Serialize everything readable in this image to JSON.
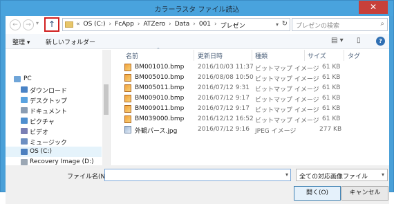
{
  "window": {
    "title": "カラーラスタ ファイル読込",
    "close_glyph": "✕"
  },
  "nav": {
    "back_glyph": "←",
    "forward_glyph": "→",
    "dropdown_glyph": "▾",
    "up_glyph": "↑",
    "breadcrumb_prefix": "«",
    "breadcrumbs": [
      "OS (C:)",
      "FcApp",
      "ATZero",
      "Data",
      "001",
      "プレゼン"
    ],
    "breadcrumb_sep": "›",
    "refresh_glyph": "↻",
    "search_placeholder": "プレゼンの検索",
    "search_glyph": "⌕"
  },
  "toolbar": {
    "organize": "整理 ▾",
    "new_folder": "新しいフォルダー",
    "view_glyph": "▤ ▾",
    "pane_glyph": "▯",
    "help_glyph": "?"
  },
  "sidebar": {
    "items": [
      {
        "label": "PC",
        "icon": "pc-icon",
        "color": "#6fa5d8",
        "indent": 0,
        "selected": false
      },
      {
        "label": "ダウンロード",
        "icon": "download-folder-icon",
        "color": "#4a83c6",
        "indent": 1,
        "selected": false
      },
      {
        "label": "デスクトップ",
        "icon": "desktop-folder-icon",
        "color": "#5aa3e0",
        "indent": 1,
        "selected": false
      },
      {
        "label": "ドキュメント",
        "icon": "documents-folder-icon",
        "color": "#8a9db3",
        "indent": 1,
        "selected": false
      },
      {
        "label": "ピクチャ",
        "icon": "pictures-folder-icon",
        "color": "#4f8fcf",
        "indent": 1,
        "selected": false
      },
      {
        "label": "ビデオ",
        "icon": "videos-folder-icon",
        "color": "#7a7fb5",
        "indent": 1,
        "selected": false
      },
      {
        "label": "ミュージック",
        "icon": "music-folder-icon",
        "color": "#6c8fc2",
        "indent": 1,
        "selected": false
      },
      {
        "label": "OS (C:)",
        "icon": "drive-icon",
        "color": "#4b7fbf",
        "indent": 1,
        "selected": true
      },
      {
        "label": "Recovery Image (D:)",
        "icon": "drive-icon",
        "color": "#9ba7b4",
        "indent": 1,
        "selected": false
      }
    ]
  },
  "files": {
    "columns": [
      "名前",
      "更新日時",
      "種類",
      "サイズ",
      "タグ"
    ],
    "sort_glyph": "⌃",
    "rows": [
      {
        "name": "BM001010.bmp",
        "date": "2016/10/03 11:37",
        "type": "ビットマップ イメージ",
        "size": "61 KB",
        "kind": "bmp"
      },
      {
        "name": "BM005010.bmp",
        "date": "2016/08/08 10:50",
        "type": "ビットマップ イメージ",
        "size": "61 KB",
        "kind": "bmp"
      },
      {
        "name": "BM005011.bmp",
        "date": "2016/07/12 9:31",
        "type": "ビットマップ イメージ",
        "size": "61 KB",
        "kind": "bmp"
      },
      {
        "name": "BM009010.bmp",
        "date": "2016/07/12 9:17",
        "type": "ビットマップ イメージ",
        "size": "61 KB",
        "kind": "bmp"
      },
      {
        "name": "BM009011.bmp",
        "date": "2016/07/12 9:17",
        "type": "ビットマップ イメージ",
        "size": "61 KB",
        "kind": "bmp"
      },
      {
        "name": "BM039000.bmp",
        "date": "2016/12/12 16:52",
        "type": "ビットマップ イメージ",
        "size": "61 KB",
        "kind": "bmp"
      },
      {
        "name": "外観パース.jpg",
        "date": "2016/07/12 9:16",
        "type": "JPEG イメージ",
        "size": "277 KB",
        "kind": "jpg"
      }
    ]
  },
  "footer": {
    "filename_label": "ファイル名(N):",
    "filename_value": "",
    "dropdown_glyph": "▾",
    "filter_value": "全ての対応画像ファイル",
    "open_label": "開く(O)",
    "cancel_label": "キャンセル"
  }
}
